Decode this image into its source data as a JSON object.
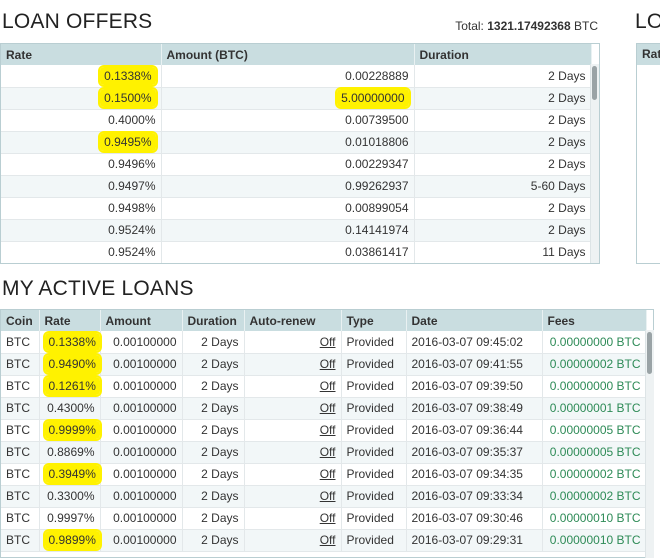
{
  "offers": {
    "title": "LOAN OFFERS",
    "total_label": "Total:",
    "total_value": "1321.17492368",
    "total_unit": "BTC",
    "columns": [
      "Rate",
      "Amount (BTC)",
      "Duration"
    ],
    "rows": [
      {
        "rate": "0.1338%",
        "amount": "0.00228889",
        "duration": "2 Days"
      },
      {
        "rate": "0.1500%",
        "amount": "5.00000000",
        "duration": "2 Days"
      },
      {
        "rate": "0.4000%",
        "amount": "0.00739500",
        "duration": "2 Days"
      },
      {
        "rate": "0.9495%",
        "amount": "0.01018806",
        "duration": "2 Days"
      },
      {
        "rate": "0.9496%",
        "amount": "0.00229347",
        "duration": "2 Days"
      },
      {
        "rate": "0.9497%",
        "amount": "0.99262937",
        "duration": "5-60 Days"
      },
      {
        "rate": "0.9498%",
        "amount": "0.00899054",
        "duration": "2 Days"
      },
      {
        "rate": "0.9524%",
        "amount": "0.14141974",
        "duration": "2 Days"
      },
      {
        "rate": "0.9524%",
        "amount": "0.03861417",
        "duration": "11 Days"
      }
    ]
  },
  "side": {
    "title_fragment": "LO",
    "col_fragment": "Rat"
  },
  "active": {
    "title": "MY ACTIVE LOANS",
    "columns": [
      "Coin",
      "Rate",
      "Amount",
      "Duration",
      "Auto-renew",
      "Type",
      "Date",
      "Fees"
    ],
    "rows": [
      {
        "coin": "BTC",
        "rate": "0.1338%",
        "amount": "0.00100000",
        "duration": "2 Days",
        "renew": "Off",
        "type": "Provided",
        "date": "2016-03-07 09:45:02",
        "fees": "0.00000000 BTC"
      },
      {
        "coin": "BTC",
        "rate": "0.9490%",
        "amount": "0.00100000",
        "duration": "2 Days",
        "renew": "Off",
        "type": "Provided",
        "date": "2016-03-07 09:41:55",
        "fees": "0.00000002 BTC"
      },
      {
        "coin": "BTC",
        "rate": "0.1261%",
        "amount": "0.00100000",
        "duration": "2 Days",
        "renew": "Off",
        "type": "Provided",
        "date": "2016-03-07 09:39:50",
        "fees": "0.00000000 BTC"
      },
      {
        "coin": "BTC",
        "rate": "0.4300%",
        "amount": "0.00100000",
        "duration": "2 Days",
        "renew": "Off",
        "type": "Provided",
        "date": "2016-03-07 09:38:49",
        "fees": "0.00000001 BTC"
      },
      {
        "coin": "BTC",
        "rate": "0.9999%",
        "amount": "0.00100000",
        "duration": "2 Days",
        "renew": "Off",
        "type": "Provided",
        "date": "2016-03-07 09:36:44",
        "fees": "0.00000005 BTC"
      },
      {
        "coin": "BTC",
        "rate": "0.8869%",
        "amount": "0.00100000",
        "duration": "2 Days",
        "renew": "Off",
        "type": "Provided",
        "date": "2016-03-07 09:35:37",
        "fees": "0.00000005 BTC"
      },
      {
        "coin": "BTC",
        "rate": "0.3949%",
        "amount": "0.00100000",
        "duration": "2 Days",
        "renew": "Off",
        "type": "Provided",
        "date": "2016-03-07 09:34:35",
        "fees": "0.00000002 BTC"
      },
      {
        "coin": "BTC",
        "rate": "0.3300%",
        "amount": "0.00100000",
        "duration": "2 Days",
        "renew": "Off",
        "type": "Provided",
        "date": "2016-03-07 09:33:34",
        "fees": "0.00000002 BTC"
      },
      {
        "coin": "BTC",
        "rate": "0.9997%",
        "amount": "0.00100000",
        "duration": "2 Days",
        "renew": "Off",
        "type": "Provided",
        "date": "2016-03-07 09:30:46",
        "fees": "0.00000010 BTC"
      },
      {
        "coin": "BTC",
        "rate": "0.9899%",
        "amount": "0.00100000",
        "duration": "2 Days",
        "renew": "Off",
        "type": "Provided",
        "date": "2016-03-07 09:29:31",
        "fees": "0.00000010 BTC"
      }
    ]
  },
  "highlight_color": "#fff200",
  "header_bg": "#c9dde0",
  "fee_color": "#2e8b57"
}
